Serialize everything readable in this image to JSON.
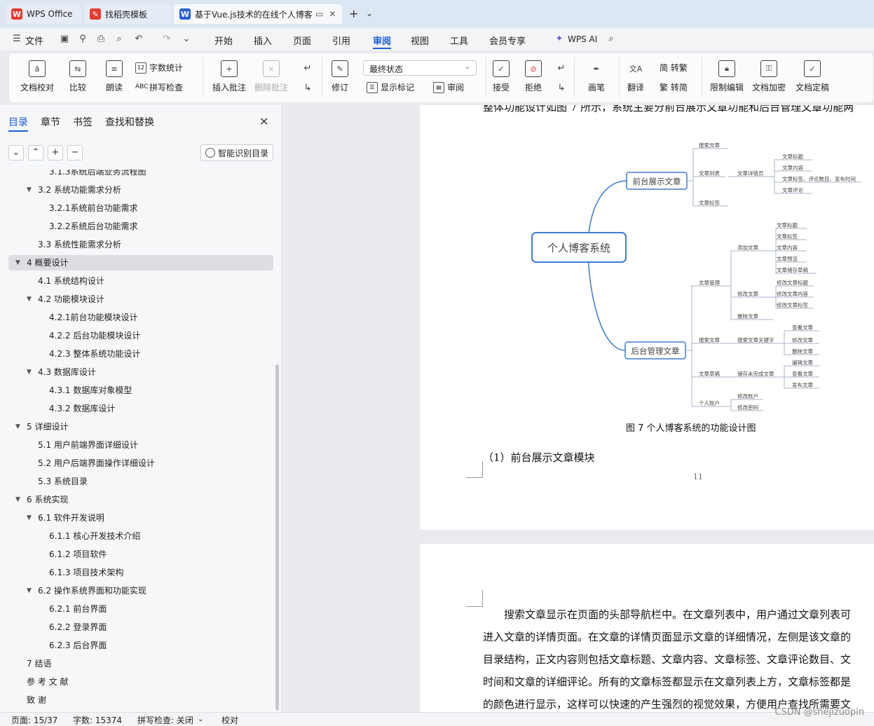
{
  "titlebar": {
    "tabs": [
      {
        "label": "WPS Office",
        "icon": "wps-logo-icon",
        "color": "#e8392d"
      },
      {
        "label": "找稻壳模板",
        "icon": "docer-icon",
        "color": "#e8392d"
      },
      {
        "label": "基于Vue.js技术的在线个人博客",
        "icon": "writer-doc-icon",
        "color": "#2b62d9"
      }
    ],
    "new_tab": "+",
    "dropdown": "⌄"
  },
  "menubar": {
    "file": "文件",
    "items": [
      "开始",
      "插入",
      "页面",
      "引用",
      "审阅",
      "视图",
      "工具",
      "会员专享"
    ],
    "active": "审阅",
    "ai": "WPS AI"
  },
  "ribbon": {
    "doc_check": "文档校对",
    "compare": "比较",
    "read_aloud": "朗读",
    "word_count": "字数统计",
    "spell_check": "拼写检查",
    "insert_comment": "插入批注",
    "delete_comment": "删除批注",
    "track": "修订",
    "state": "最终状态",
    "show_markup": "显示标记",
    "review": "审阅",
    "accept": "接受",
    "reject": "拒绝",
    "pen": "画笔",
    "translate": "翻译",
    "to_traditional": "简 转繁",
    "to_simplified": "繁 转简",
    "restrict_edit": "限制编辑",
    "encrypt": "文档加密",
    "finalize": "文档定稿"
  },
  "navpane": {
    "tabs": [
      "目录",
      "章节",
      "书签",
      "查找和替换"
    ],
    "smart_toc": "智能识别目录",
    "toc": [
      {
        "text": "3.1.3系统后端业务流程图",
        "level": 3,
        "caret": ""
      },
      {
        "text": "3.2   系统功能需求分析",
        "level": 2,
        "caret": "▼"
      },
      {
        "text": "3.2.1系统前台功能需求",
        "level": 3,
        "caret": ""
      },
      {
        "text": "3.2.2系统后台功能需求",
        "level": 3,
        "caret": ""
      },
      {
        "text": "3.3   系统性能需求分析",
        "level": 2,
        "caret": ""
      },
      {
        "text": "4   概要设计",
        "level": 1,
        "caret": "▼",
        "selected": true
      },
      {
        "text": "4.1   系统结构设计",
        "level": 2,
        "caret": ""
      },
      {
        "text": "4.2   功能模块设计",
        "level": 2,
        "caret": "▼"
      },
      {
        "text": "4.2.1前台功能模块设计",
        "level": 3,
        "caret": ""
      },
      {
        "text": "4.2.2  后台功能模块设计",
        "level": 3,
        "caret": ""
      },
      {
        "text": "4.2.3  整体系统功能设计",
        "level": 3,
        "caret": ""
      },
      {
        "text": "4.3   数据库设计",
        "level": 2,
        "caret": "▼"
      },
      {
        "text": "4.3.1  数据库对象模型",
        "level": 3,
        "caret": ""
      },
      {
        "text": "4.3.2    数据库设计",
        "level": 3,
        "caret": ""
      },
      {
        "text": "5   详细设计",
        "level": 1,
        "caret": "▼"
      },
      {
        "text": "5.1   用户前端界面详细设计",
        "level": 2,
        "caret": ""
      },
      {
        "text": "5.2   用户后端界面操作详细设计",
        "level": 2,
        "caret": ""
      },
      {
        "text": "5.3   系统目录",
        "level": 2,
        "caret": ""
      },
      {
        "text": "6   系统实现",
        "level": 1,
        "caret": "▼"
      },
      {
        "text": "6.1   软件开发说明",
        "level": 2,
        "caret": "▼"
      },
      {
        "text": "6.1.1    核心开发技术介绍",
        "level": 3,
        "caret": ""
      },
      {
        "text": "6.1.2    项目软件",
        "level": 3,
        "caret": ""
      },
      {
        "text": "6.1.3  项目技术架构",
        "level": 3,
        "caret": ""
      },
      {
        "text": "6.2   操作系统界面和功能实现",
        "level": 2,
        "caret": "▼"
      },
      {
        "text": "6.2.1    前台界面",
        "level": 3,
        "caret": ""
      },
      {
        "text": "6.2.2    登录界面",
        "level": 3,
        "caret": ""
      },
      {
        "text": "6.2.3    后台界面",
        "level": 3,
        "caret": ""
      },
      {
        "text": "7    结语",
        "level": 1,
        "caret": ""
      },
      {
        "text": "参   考   文   献",
        "level": 1,
        "caret": ""
      },
      {
        "text": "致          谢",
        "level": 1,
        "caret": ""
      }
    ]
  },
  "document": {
    "page1_top_line": "整体功能设计如图 7 所示，系统主要分前台展示文章功能和后台管理文章功能两",
    "figure_caption": "图 7  个人博客系统的功能设计图",
    "section_heading": "（1）前台展示文章模块",
    "page_number": "11",
    "page2_lines": [
      "搜索文章显示在页面的头部导航栏中。在文章列表中，用户通过文章列表可",
      "进入文章的详情页面。在文章的详情页面显示文章的详细情况，左侧是该文章的",
      "目录结构，正文内容则包括文章标题、文章内容、文章标签、文章评论数目、文",
      "时间和文章的详细评论。所有的文章标签都显示在文章列表上方，文章标签都是",
      "的颜色进行显示，这样可以快速的产生强烈的视觉效果，方便用户查找所需要文"
    ],
    "mindmap": {
      "root": "个人博客系统",
      "front": "前台展示文章",
      "back": "后台管理文章",
      "f_search": "搜索文章",
      "f_list": "文章列表",
      "f_detail": "文章详情页",
      "f_title": "文章标题",
      "f_content": "文章内容",
      "f_meta": "文章标签、评论数目、发布时间",
      "f_comment": "文章评论",
      "f_tags": "文章标签",
      "b_manage": "文章管理",
      "b_add": "添加文章",
      "b_add_title": "文章标题",
      "b_add_tag": "文章标签",
      "b_add_content": "文章内容",
      "b_add_preview": "文章预览",
      "b_add_draft": "文章储存草稿",
      "b_edit": "修改文章",
      "b_edit_title": "修改文章标题",
      "b_edit_content": "修改文章内容",
      "b_edit_tag": "修改文章标签",
      "b_delete": "删除文章",
      "b_search": "搜索文章",
      "b_keyword": "搜索文章关键字",
      "b_view": "查看文章",
      "b_modify": "修改文章",
      "b_remove": "删除文章",
      "b_draft": "文章草稿",
      "b_store": "储存未完成文章",
      "b_d_edit": "编辑文章",
      "b_d_view": "查看文章",
      "b_d_publish": "发布文章",
      "b_account": "个人账户",
      "b_acc_edit": "修改账户",
      "b_acc_pwd": "修改密码"
    }
  },
  "statusbar": {
    "page": "页面: 15/37",
    "words": "字数: 15374",
    "spell": "拼写检查: 关闭",
    "proof": "校对"
  },
  "watermark": "CSDN @shejizuopin"
}
